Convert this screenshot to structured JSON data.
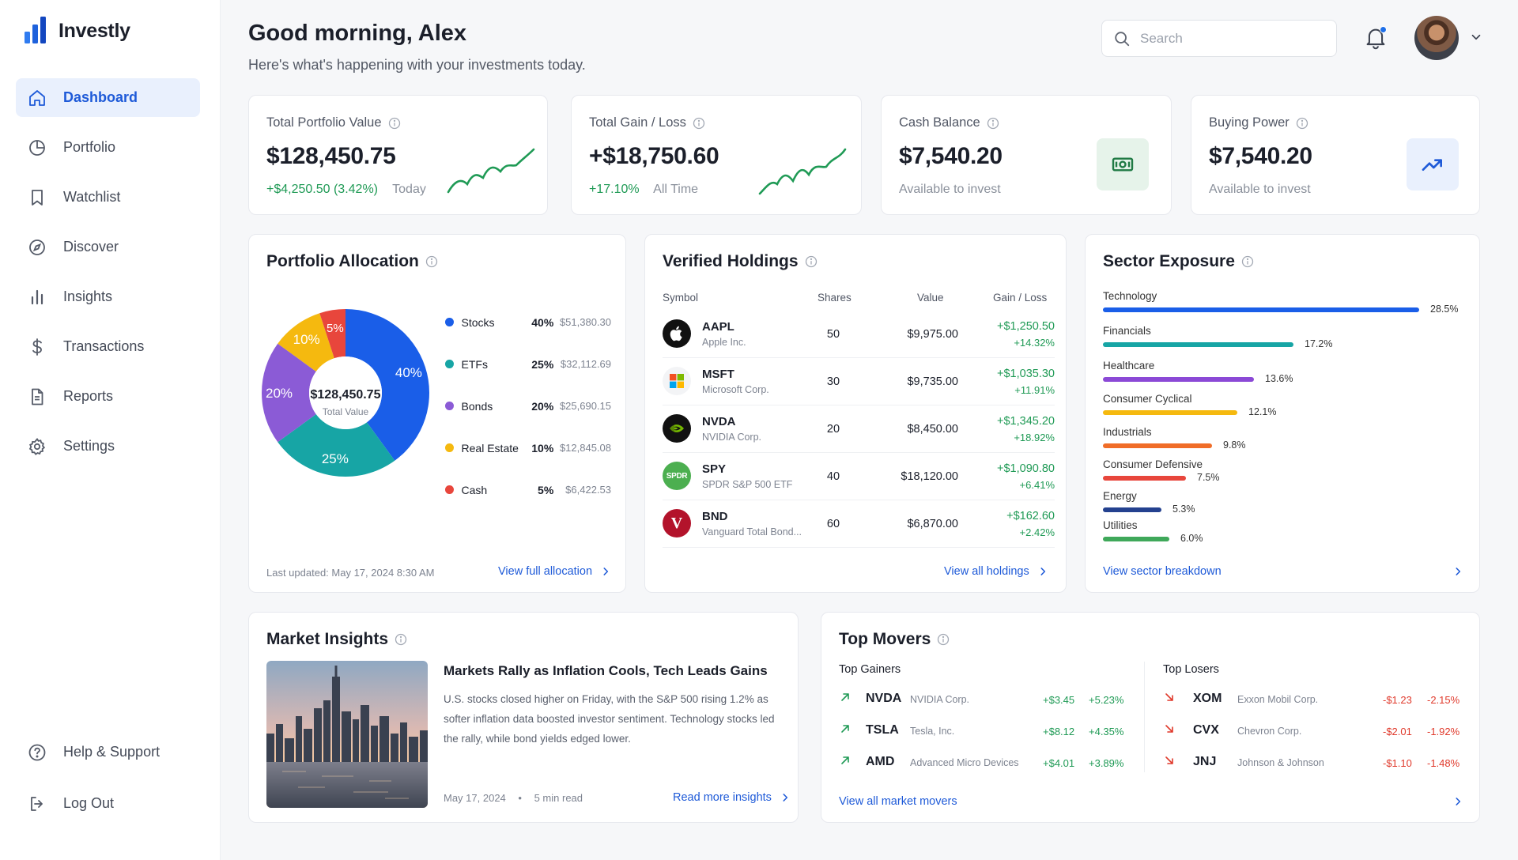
{
  "app": {
    "name": "Investly"
  },
  "nav": {
    "items": [
      {
        "label": "Dashboard",
        "icon": "home-icon"
      },
      {
        "label": "Portfolio",
        "icon": "pie-icon"
      },
      {
        "label": "Watchlist",
        "icon": "bookmark-icon"
      },
      {
        "label": "Discover",
        "icon": "compass-icon"
      },
      {
        "label": "Insights",
        "icon": "bar-chart-icon"
      },
      {
        "label": "Transactions",
        "icon": "dollar-icon"
      },
      {
        "label": "Reports",
        "icon": "document-icon"
      },
      {
        "label": "Settings",
        "icon": "gear-icon"
      }
    ],
    "bottom": [
      {
        "label": "Help & Support",
        "icon": "help-icon"
      },
      {
        "label": "Log Out",
        "icon": "logout-icon"
      }
    ]
  },
  "header": {
    "greeting": "Good morning, Alex",
    "subtitle": "Here's what's happening with your investments today.",
    "search_placeholder": "Search"
  },
  "stats": {
    "portfolio": {
      "label": "Total Portfolio Value",
      "value": "$128,450.75",
      "change": "+$4,250.50 (3.42%)",
      "period": "Today"
    },
    "gain": {
      "label": "Total Gain / Loss",
      "value": "+$18,750.60",
      "change": "+17.10%",
      "period": "All Time"
    },
    "cash": {
      "label": "Cash Balance",
      "value": "$7,540.20",
      "sub": "Available to invest"
    },
    "buying": {
      "label": "Buying Power",
      "value": "$7,540.20",
      "sub": "Available to invest"
    }
  },
  "allocation": {
    "title": "Portfolio Allocation",
    "center_value": "$128,450.75",
    "center_label": "Total Value",
    "items": [
      {
        "name": "Stocks",
        "pct": "40%",
        "amount": "$51,380.30",
        "color": "#1a5ee8"
      },
      {
        "name": "ETFs",
        "pct": "25%",
        "amount": "$32,112.69",
        "color": "#17a5a5"
      },
      {
        "name": "Bonds",
        "pct": "20%",
        "amount": "$25,690.15",
        "color": "#8b5bd6"
      },
      {
        "name": "Real Estate",
        "pct": "10%",
        "amount": "$12,845.08",
        "color": "#f5b90f"
      },
      {
        "name": "Cash",
        "pct": "5%",
        "amount": "$6,422.53",
        "color": "#e8463c"
      }
    ],
    "updated": "Last updated: May 17, 2024 8:30 AM",
    "link": "View full allocation"
  },
  "holdings": {
    "title": "Verified Holdings",
    "columns": {
      "symbol": "Symbol",
      "shares": "Shares",
      "value": "Value",
      "gain": "Gain / Loss"
    },
    "rows": [
      {
        "symbol": "AAPL",
        "name": "Apple Inc.",
        "shares": "50",
        "value": "$9,975.00",
        "gain": "+$1,250.50",
        "gain_pct": "+14.32%"
      },
      {
        "symbol": "MSFT",
        "name": "Microsoft Corp.",
        "shares": "30",
        "value": "$9,735.00",
        "gain": "+$1,035.30",
        "gain_pct": "+11.91%"
      },
      {
        "symbol": "NVDA",
        "name": "NVIDIA Corp.",
        "shares": "20",
        "value": "$8,450.00",
        "gain": "+$1,345.20",
        "gain_pct": "+18.92%"
      },
      {
        "symbol": "SPY",
        "name": "SPDR S&P 500 ETF",
        "shares": "40",
        "value": "$18,120.00",
        "gain": "+$1,090.80",
        "gain_pct": "+6.41%",
        "logo_text": "SPDR"
      },
      {
        "symbol": "BND",
        "name": "Vanguard Total Bond...",
        "shares": "60",
        "value": "$6,870.00",
        "gain": "+$162.60",
        "gain_pct": "+2.42%",
        "logo_text": "V"
      }
    ],
    "link": "View all holdings"
  },
  "sectors": {
    "title": "Sector Exposure",
    "items": [
      {
        "name": "Technology",
        "value": 28.5,
        "label": "28.5%",
        "color": "#1a5ee8"
      },
      {
        "name": "Financials",
        "value": 17.2,
        "label": "17.2%",
        "color": "#17a5a5"
      },
      {
        "name": "Healthcare",
        "value": 13.6,
        "label": "13.6%",
        "color": "#8b49d6"
      },
      {
        "name": "Consumer Cyclical",
        "value": 12.1,
        "label": "12.1%",
        "color": "#f5b90f"
      },
      {
        "name": "Industrials",
        "value": 9.8,
        "label": "9.8%",
        "color": "#f06d28"
      },
      {
        "name": "Consumer Defensive",
        "value": 7.5,
        "label": "7.5%",
        "color": "#e8463c"
      },
      {
        "name": "Energy",
        "value": 5.3,
        "label": "5.3%",
        "color": "#24418f"
      },
      {
        "name": "Utilities",
        "value": 6.0,
        "label": "6.0%",
        "color": "#3fa85a"
      }
    ],
    "link": "View sector breakdown"
  },
  "insights": {
    "title": "Market Insights",
    "headline": "Markets Rally as Inflation Cools, Tech Leads Gains",
    "body": "U.S. stocks closed higher on Friday, with the S&P 500 rising 1.2% as softer inflation data boosted investor sentiment. Technology stocks led the rally, while bond yields edged lower.",
    "date": "May 17, 2024",
    "read_time": "5 min read",
    "link": "Read more insights"
  },
  "movers": {
    "title": "Top Movers",
    "gainers_title": "Top Gainers",
    "losers_title": "Top Losers",
    "gainers": [
      {
        "symbol": "NVDA",
        "name": "NVIDIA Corp.",
        "change": "+$3.45",
        "pct": "+5.23%"
      },
      {
        "symbol": "TSLA",
        "name": "Tesla, Inc.",
        "change": "+$8.12",
        "pct": "+4.35%"
      },
      {
        "symbol": "AMD",
        "name": "Advanced Micro Devices",
        "change": "+$4.01",
        "pct": "+3.89%"
      }
    ],
    "losers": [
      {
        "symbol": "XOM",
        "name": "Exxon Mobil Corp.",
        "change": "-$1.23",
        "pct": "-2.15%"
      },
      {
        "symbol": "CVX",
        "name": "Chevron Corp.",
        "change": "-$2.01",
        "pct": "-1.92%"
      },
      {
        "symbol": "JNJ",
        "name": "Johnson & Johnson",
        "change": "-$1.10",
        "pct": "-1.48%"
      }
    ],
    "link": "View all market movers"
  },
  "colors": {
    "accent": "#1e5ad8",
    "positive": "#1f9a55",
    "negative": "#e0392b"
  }
}
